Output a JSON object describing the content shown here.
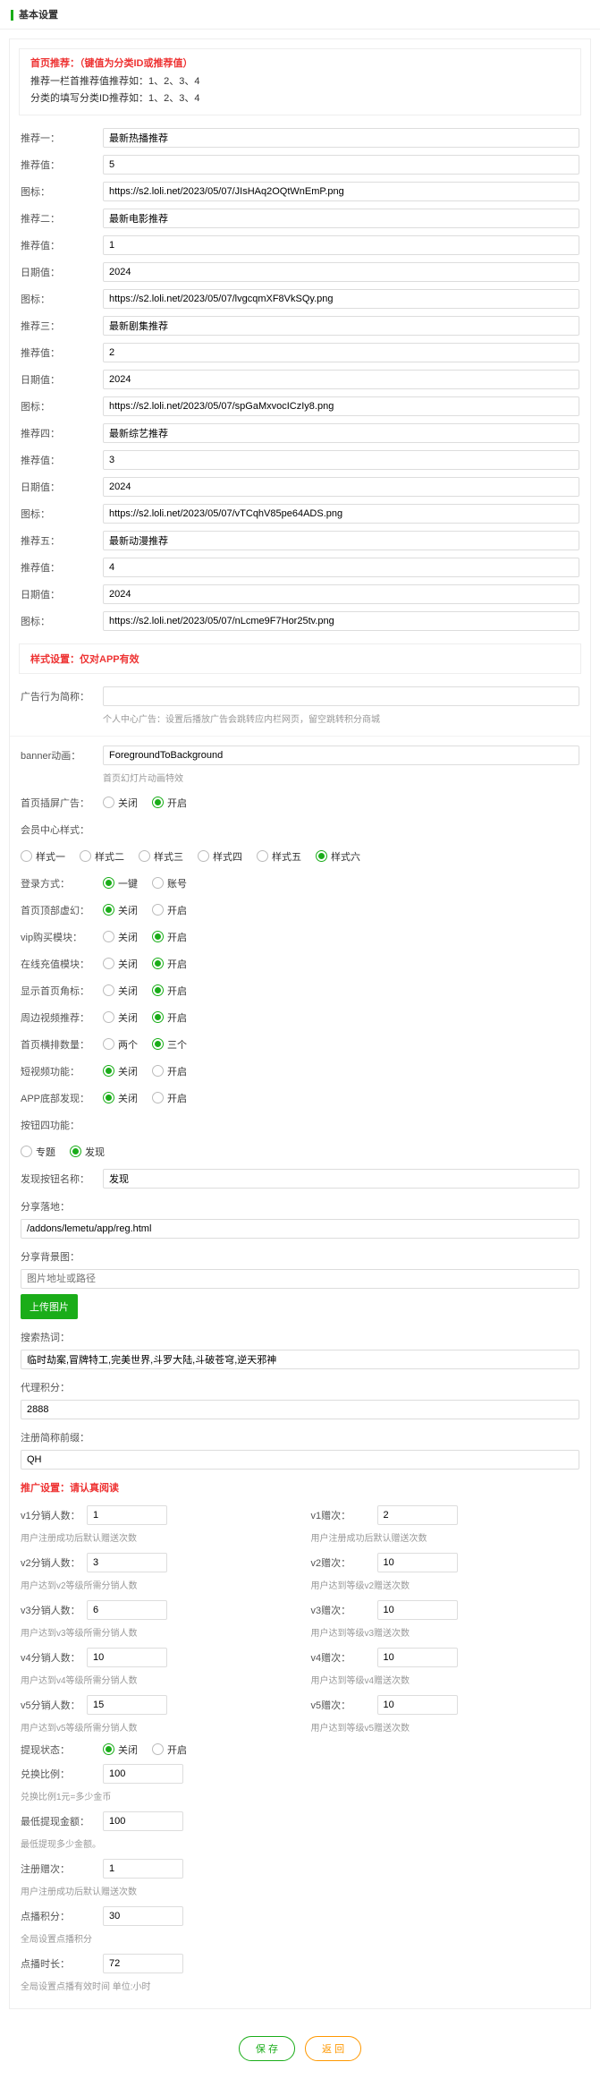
{
  "section_title": "基本设置",
  "head_warning": {
    "title": "首页推荐：（键值为分类ID或推荐值）",
    "line1": "推荐一栏首推荐值推荐如：1、2、3、4",
    "line2": "分类的填写分类ID推荐如：1、2、3、4"
  },
  "recommend": [
    {
      "title_label": "推荐一：",
      "title_value": "最新热播推荐",
      "save_label": "推荐值：",
      "save_value": "5",
      "date_label": "",
      "date_value": "",
      "icon_label": "图标：",
      "icon_value": "https://s2.loli.net/2023/05/07/JIsHAq2OQtWnEmP.png"
    },
    {
      "title_label": "推荐二：",
      "title_value": "最新电影推荐",
      "save_label": "推荐值：",
      "save_value": "1",
      "date_label": "日期值：",
      "date_value": "2024",
      "icon_label": "图标：",
      "icon_value": "https://s2.loli.net/2023/05/07/lvgcqmXF8VkSQy.png"
    },
    {
      "title_label": "推荐三：",
      "title_value": "最新剧集推荐",
      "save_label": "推荐值：",
      "save_value": "2",
      "date_label": "日期值：",
      "date_value": "2024",
      "icon_label": "图标：",
      "icon_value": "https://s2.loli.net/2023/05/07/spGaMxvocICzIy8.png"
    },
    {
      "title_label": "推荐四：",
      "title_value": "最新综艺推荐",
      "save_label": "推荐值：",
      "save_value": "3",
      "date_label": "日期值：",
      "date_value": "2024",
      "icon_label": "图标：",
      "icon_value": "https://s2.loli.net/2023/05/07/vTCqhV85pe64ADS.png"
    },
    {
      "title_label": "推荐五：",
      "title_value": "最新动漫推荐",
      "save_label": "推荐值：",
      "save_value": "4",
      "date_label": "日期值：",
      "date_value": "2024",
      "icon_label": "图标：",
      "icon_value": "https://s2.loli.net/2023/05/07/nLcme9F7Hor25tv.png"
    }
  ],
  "style_warning": "样式设置：仅对APP有效",
  "ad_behavior": {
    "label": "广告行为简称：",
    "value": "",
    "hint": "个人中心广告：设置后播放广告会跳转应内栏网页，留空跳转积分商城"
  },
  "banner": {
    "label": "banner动画：",
    "value": "ForegroundToBackground",
    "hint": "首页幻灯片动画特效"
  },
  "radios": {
    "splash_ad": {
      "label": "首页插屏广告：",
      "opt_off": "关闭",
      "opt_on": "开启",
      "selected": "on"
    },
    "member_style": {
      "label": "会员中心样式：",
      "options": [
        "样式一",
        "样式二",
        "样式三",
        "样式四",
        "样式五",
        "样式六"
      ],
      "selected_index": 5
    },
    "login_mode": {
      "label": "登录方式：",
      "opt_a": "一键",
      "opt_b": "账号",
      "selected": "a"
    },
    "top_slide": {
      "label": "首页顶部虚幻：",
      "opt_off": "关闭",
      "opt_on": "开启",
      "selected": "off"
    },
    "vip_buy": {
      "label": "vip购买模块：",
      "opt_off": "关闭",
      "opt_on": "开启",
      "selected": "on"
    },
    "online_cz": {
      "label": "在线充值模块：",
      "opt_off": "关闭",
      "opt_on": "开启",
      "selected": "on"
    },
    "show_home": {
      "label": "显示首页角标：",
      "opt_off": "关闭",
      "opt_on": "开启",
      "selected": "on"
    },
    "around_rec": {
      "label": "周边视频推荐：",
      "opt_off": "关闭",
      "opt_on": "开启",
      "selected": "on"
    },
    "home_rows": {
      "label": "首页横排数量：",
      "opt_a": "两个",
      "opt_b": "三个",
      "selected": "b"
    },
    "short_video": {
      "label": "短视频功能：",
      "opt_off": "关闭",
      "opt_on": "开启",
      "selected": "off"
    },
    "app_discover": {
      "label": "APP底部发现：",
      "opt_off": "关闭",
      "opt_on": "开启",
      "selected": "off"
    },
    "btn4": {
      "label": "按钮四功能：",
      "opt_a": "专题",
      "opt_b": "发现",
      "selected": "b"
    }
  },
  "discover_btn_name": {
    "label": "发现按钮名称：",
    "value": "发现"
  },
  "share_url": {
    "label": "分享落地：",
    "value": "/addons/lemetu/app/reg.html"
  },
  "share_bg": {
    "label": "分享背景图：",
    "placeholder": "图片地址或路径",
    "btn": "上传图片"
  },
  "search_hot": {
    "label": "搜索热词：",
    "value": "临时劫案,冒牌特工,完美世界,斗罗大陆,斗破苍穹,逆天邪神"
  },
  "agent_points": {
    "label": "代理积分：",
    "value": "2888"
  },
  "reg_prefix": {
    "label": "注册简称前缀：",
    "value": "QH"
  },
  "promo_warning": "推广设置：请认真阅读",
  "promo": {
    "left": [
      {
        "label": "v1分销人数：",
        "value": "1",
        "hint": "用户注册成功后默认赠送次数"
      },
      {
        "label": "v2分销人数：",
        "value": "3",
        "hint": "用户达到v2等级所需分销人数"
      },
      {
        "label": "v3分销人数：",
        "value": "6",
        "hint": "用户达到v3等级所需分销人数"
      },
      {
        "label": "v4分销人数：",
        "value": "10",
        "hint": "用户达到v4等级所需分销人数"
      },
      {
        "label": "v5分销人数：",
        "value": "15",
        "hint": "用户达到v5等级所需分销人数"
      }
    ],
    "right": [
      {
        "label": "v1赠次：",
        "value": "2",
        "hint": "用户注册成功后默认赠送次数"
      },
      {
        "label": "v2赠次：",
        "value": "10",
        "hint": "用户达到等级v2赠送次数"
      },
      {
        "label": "v3赠次：",
        "value": "10",
        "hint": "用户达到等级v3赠送次数"
      },
      {
        "label": "v4赠次：",
        "value": "10",
        "hint": "用户达到等级v4赠送次数"
      },
      {
        "label": "v5赠次：",
        "value": "10",
        "hint": "用户达到等级v5赠送次数"
      }
    ]
  },
  "tx_status": {
    "label": "提现状态：",
    "opt_off": "关闭",
    "opt_on": "开启",
    "selected": "off"
  },
  "exchange": {
    "label": "兑换比例：",
    "value": "100",
    "hint": "兑换比例1元=多少金币"
  },
  "min_withdraw": {
    "label": "最低提现金额：",
    "value": "100",
    "hint": "最低提现多少金额。"
  },
  "reg_gift": {
    "label": "注册赠次：",
    "value": "1",
    "hint": "用户注册成功后默认赠送次数"
  },
  "point_score": {
    "label": "点播积分：",
    "value": "30",
    "hint": "全局设置点播积分"
  },
  "point_hours": {
    "label": "点播时长：",
    "value": "72",
    "hint": "全局设置点播有效时间 单位:小时"
  },
  "footer": {
    "save": "保 存",
    "back": "返 回"
  }
}
